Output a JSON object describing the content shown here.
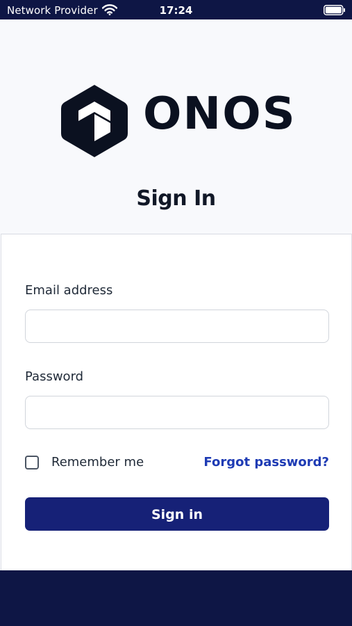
{
  "status_bar": {
    "carrier": "Network Provider",
    "time": "17:24",
    "icons": [
      "wifi-icon",
      "battery-icon"
    ]
  },
  "brand": {
    "name": "ONOS",
    "logo_icon": "hexagon-cube-logo-icon"
  },
  "page": {
    "title": "Sign In"
  },
  "form": {
    "email_label": "Email address",
    "email_value": "",
    "password_label": "Password",
    "password_value": "",
    "remember_label": "Remember me",
    "remember_checked": false,
    "forgot_link": "Forgot password?",
    "submit_label": "Sign in"
  },
  "colors": {
    "header_bg": "#f8f9fc",
    "dark_navy": "#0e1645",
    "button_bg": "#162177",
    "link": "#1e3bb4",
    "logo": "#0b1120"
  }
}
